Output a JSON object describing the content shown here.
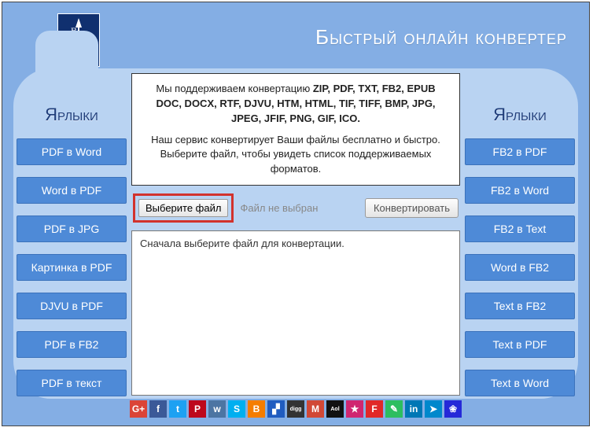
{
  "header": {
    "title": "Быстрый онлайн конвертер"
  },
  "info": {
    "line1_prefix": "Мы поддерживаем конвертацию ",
    "formats": "ZIP, PDF, TXT, FB2, EPUB DOC, DOCX, RTF, DJVU, HTM, HTML, TIF, TIFF, BMP, JPG, JPEG, JFIF, PNG, GIF, ICO.",
    "line2": "Наш сервис конвертирует Ваши файлы бесплатно и быстро. Выберите файл, чтобы увидеть список поддерживаемых форматов."
  },
  "sidebar_left": {
    "title": "Ярлыки",
    "items": [
      "PDF в Word",
      "Word в PDF",
      "PDF в JPG",
      "Картинка в PDF",
      "DJVU в PDF",
      "PDF в FB2",
      "PDF в текст"
    ]
  },
  "sidebar_right": {
    "title": "Ярлыки",
    "items": [
      "FB2 в PDF",
      "FB2 в Word",
      "FB2 в Text",
      "Word в FB2",
      "Text в FB2",
      "Text в PDF",
      "Text в Word"
    ]
  },
  "picker": {
    "choose_label": "Выберите файл",
    "no_file": "Файл не выбран",
    "convert_label": "Конвертировать"
  },
  "output": {
    "placeholder": "Сначала выберите файл для конвертации."
  },
  "social": [
    {
      "name": "google-plus",
      "bg": "#db4437",
      "glyph": "G+"
    },
    {
      "name": "facebook",
      "bg": "#3b5998",
      "glyph": "f"
    },
    {
      "name": "twitter",
      "bg": "#1da1f2",
      "glyph": "t"
    },
    {
      "name": "pinterest",
      "bg": "#bd081c",
      "glyph": "P"
    },
    {
      "name": "vk",
      "bg": "#4c75a3",
      "glyph": "w"
    },
    {
      "name": "skype",
      "bg": "#00aff0",
      "glyph": "S"
    },
    {
      "name": "blogger",
      "bg": "#f57d00",
      "glyph": "B"
    },
    {
      "name": "delicious",
      "bg": "#205cc0",
      "glyph": "▞"
    },
    {
      "name": "digg",
      "bg": "#333333",
      "glyph": "digg"
    },
    {
      "name": "gmail",
      "bg": "#d14836",
      "glyph": "M"
    },
    {
      "name": "aol",
      "bg": "#111111",
      "glyph": "Aol"
    },
    {
      "name": "favorite",
      "bg": "#d02670",
      "glyph": "★"
    },
    {
      "name": "flipboard",
      "bg": "#e12828",
      "glyph": "F"
    },
    {
      "name": "evernote",
      "bg": "#2dbe60",
      "glyph": "✎"
    },
    {
      "name": "linkedin",
      "bg": "#0077b5",
      "glyph": "in"
    },
    {
      "name": "telegram",
      "bg": "#0088cc",
      "glyph": "➤"
    },
    {
      "name": "baidu",
      "bg": "#2529d8",
      "glyph": "❀"
    }
  ]
}
